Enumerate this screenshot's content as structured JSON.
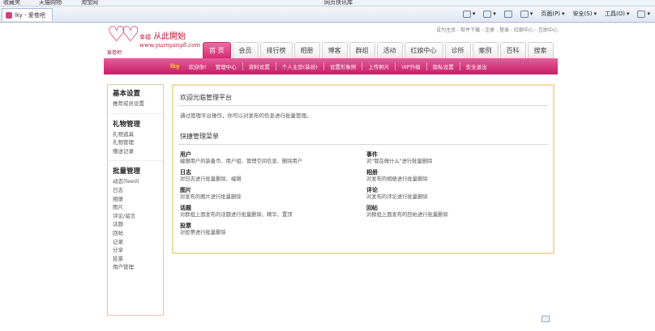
{
  "browser": {
    "favorites": [
      "收藏夹",
      "天猫购物",
      "淘宝网",
      "网页快讯库"
    ],
    "tab_title": "lky - 爱卷吧",
    "commands": [
      {
        "label": "",
        "icon": "home-icon"
      },
      {
        "label": "",
        "icon": "feeds-icon"
      },
      {
        "label": "",
        "icon": "mail-icon"
      },
      {
        "label": "",
        "icon": "print-icon"
      },
      {
        "label": "页面(P)",
        "icon": "page-icon"
      },
      {
        "label": "安全(S)",
        "icon": "safety-icon"
      },
      {
        "label": "工具(O)",
        "icon": "tools-icon"
      },
      {
        "label": "",
        "icon": "help-icon"
      }
    ]
  },
  "site": {
    "top_links": "设为主页 - 软件下载 - 注册 - 登录 - 红娘中心 - 互助中心",
    "logo": {
      "mark": "♡♡",
      "slogan_small": "幸福",
      "slogan": "从此開始",
      "url": "www.yuanyang8.com",
      "sub": "爱卷吧"
    },
    "nav": [
      "首 页",
      "会员",
      "排行榜",
      "相册",
      "博客",
      "群组",
      "活动",
      "红娘中心",
      "诊所",
      "案例",
      "百科",
      "搜索"
    ],
    "sub_nav": {
      "user": "lky",
      "items": [
        "欢迎你!",
        "管理中心",
        "资料设置",
        "个人主页(装扮)",
        "设置形象照",
        "上传照片",
        "VIP升级",
        "隐私设置",
        "安全退出"
      ]
    }
  },
  "sidebar": {
    "groups": [
      {
        "title": "基本设置",
        "links": [
          "推荐成员设置"
        ]
      },
      {
        "title": "礼物管理",
        "links": [
          "礼物道具",
          "礼物管理",
          "赠送记录"
        ]
      },
      {
        "title": "批量管理",
        "links": [
          "动态(feed)",
          "日志",
          "相册",
          "图片",
          "评论/留言",
          "话题",
          "回帖",
          "记录",
          "分享",
          "投票",
          "用户管理"
        ]
      }
    ]
  },
  "content": {
    "welcome": "欢迎光临管理平台",
    "intro": "通过管理平台操作，你可以对发布的信息进行批量管理。",
    "quick_title": "快捷管理菜单",
    "items": [
      {
        "title": "用户",
        "desc": "编辑用户的装备币、用户组、管理空间信息、删除用户"
      },
      {
        "title": "事件",
        "desc": "对\"我在做什么\"进行批量删除"
      },
      {
        "title": "日志",
        "desc": "对日志进行批量删除、编辑"
      },
      {
        "title": "相册",
        "desc": "对发布的相册进行批量删除"
      },
      {
        "title": "图片",
        "desc": "对发布的图片进行批量删除"
      },
      {
        "title": "评论",
        "desc": "对发布的评论进行批量删除"
      },
      {
        "title": "话题",
        "desc": "对群组上面发布的话题进行批量删除、精华、置顶"
      },
      {
        "title": "回帖",
        "desc": "对群组上面发布的回帖进行批量删除"
      },
      {
        "title": "投票",
        "desc": "对投票进行批量删除"
      }
    ]
  },
  "colors": {
    "accent": "#d42c72",
    "sub_nav": "#c41f66",
    "panel_border": "#f0dca8"
  }
}
